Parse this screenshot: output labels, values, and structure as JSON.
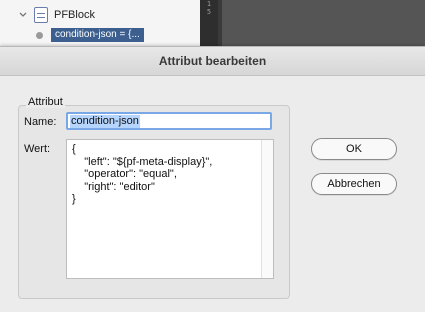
{
  "background": {
    "tree_item_label": "PFBlock",
    "attribute_chip": "condition-json = {...",
    "ruler_marks": [
      "1",
      "5"
    ]
  },
  "dialog": {
    "title": "Attribut bearbeiten",
    "group_title": "Attribut",
    "name_label": "Name:",
    "name_value": "condition-json",
    "value_label": "Wert:",
    "value_text": "{\n    \"left\": \"${pf-meta-display}\",\n    \"operator\": \"equal\",\n    \"right\": \"editor\"\n}",
    "ok_label": "OK",
    "cancel_label": "Abbrechen"
  },
  "colors": {
    "selection": "#b5d5ff",
    "focus_ring": "#7aa7e6",
    "chip": "#3c5f8f"
  }
}
